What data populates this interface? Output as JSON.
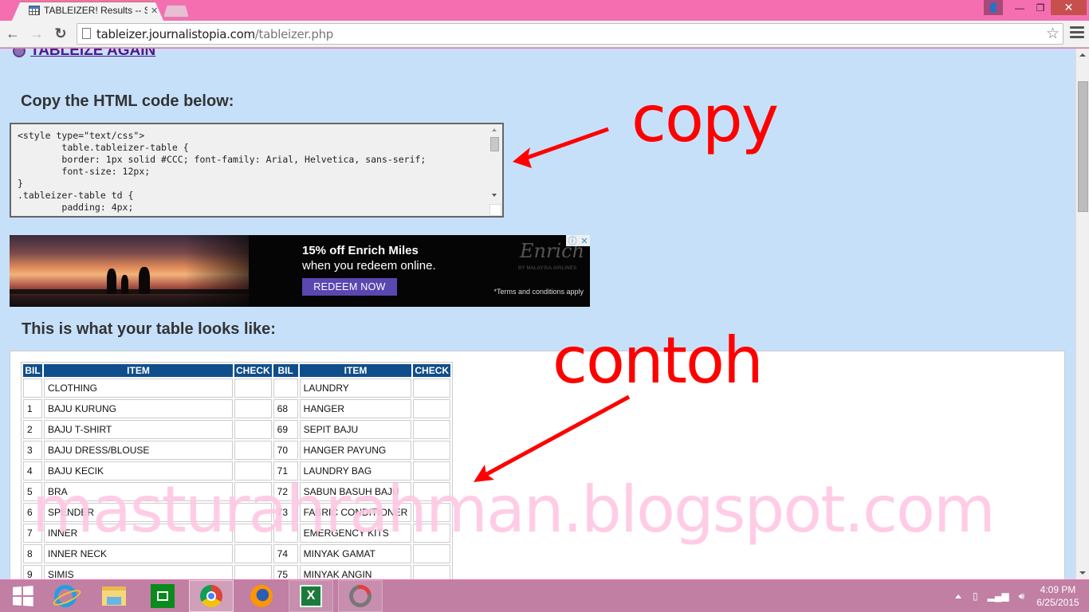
{
  "browser": {
    "tab_title": "TABLEIZER! Results -- Spre",
    "url_host": "tableizer.journalistopia.com",
    "url_path": "/tableizer.php",
    "icons": {
      "back": "arrow-left-icon",
      "forward": "arrow-right-icon",
      "reload": "reload-icon",
      "bookmark": "star-icon",
      "menu": "hamburger-menu-icon"
    },
    "window_controls": {
      "user": "👤",
      "minimize": "—",
      "maximize": "❐",
      "close": "✕"
    }
  },
  "page": {
    "tableize_again": "TABLEIZE AGAIN",
    "copy_heading": "Copy the HTML code below:",
    "code_text": "<style type=\"text/css\">\n\ttable.tableizer-table {\n\tborder: 1px solid #CCC; font-family: Arial, Helvetica, sans-serif;\n\tfont-size: 12px;\n}\n.tableizer-table td {\n\tpadding: 4px;",
    "preview_heading": "This is what your table looks like:"
  },
  "ad": {
    "headline": "15% off Enrich Miles",
    "subline": "when you redeem online.",
    "cta": "REDEEM NOW",
    "brand": "Enrich",
    "brand_sub": "BY MALAYSIA AIRLINES",
    "terms": "*Terms and conditions apply",
    "adchoices_info": "ⓘ",
    "adchoices_close": "✕",
    "colors": {
      "cta": "#5b47b0"
    }
  },
  "table": {
    "header_color": "#104e8b",
    "headers": [
      "BIL",
      "ITEM",
      "CHECK",
      "BIL",
      "ITEM",
      "CHECK"
    ],
    "rows": [
      [
        "",
        "CLOTHING",
        "",
        "",
        "LAUNDRY",
        ""
      ],
      [
        "1",
        "BAJU KURUNG",
        "",
        "68",
        "HANGER",
        ""
      ],
      [
        "2",
        "BAJU T-SHIRT",
        "",
        "69",
        "SEPIT BAJU",
        ""
      ],
      [
        "3",
        "BAJU DRESS/BLOUSE",
        "",
        "70",
        "HANGER PAYUNG",
        ""
      ],
      [
        "4",
        "BAJU KECIK",
        "",
        "71",
        "LAUNDRY BAG",
        ""
      ],
      [
        "5",
        "BRA",
        "",
        "72",
        "SABUN BASUH BAJU",
        ""
      ],
      [
        "6",
        "SPENDER",
        "",
        "73",
        "FABRIC CONDITIONER",
        ""
      ],
      [
        "7",
        "INNER",
        "",
        "",
        "EMERGENCY KITS",
        ""
      ],
      [
        "8",
        "INNER NECK",
        "",
        "74",
        "MINYAK GAMAT",
        ""
      ],
      [
        "9",
        "SIMIS",
        "",
        "75",
        "MINYAK ANGIN",
        ""
      ]
    ]
  },
  "annotations": {
    "copy": "copy",
    "contoh": "contoh",
    "watermark": "masturahrahman.blogspot.com",
    "color": "#ff0000"
  },
  "taskbar": {
    "apps": [
      "start",
      "internet-explorer",
      "file-explorer",
      "windows-store",
      "chrome",
      "firefox",
      "excel",
      "app"
    ],
    "excel_letter": "X",
    "clock_time": "4:09 PM",
    "clock_date": "6/25/2015"
  }
}
